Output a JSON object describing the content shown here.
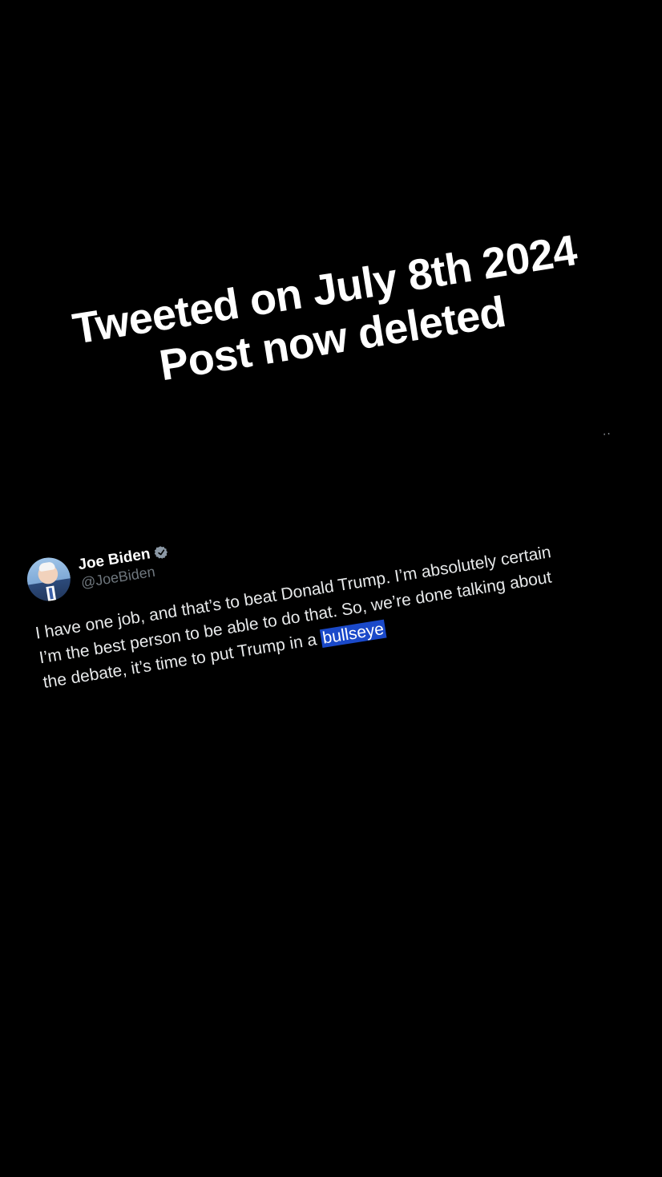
{
  "caption": {
    "line1": "Tweeted on July 8th 2024",
    "line2": "Post now deleted"
  },
  "more_menu": {
    "label": "··"
  },
  "tweet": {
    "display_name": "Joe Biden",
    "handle": "@JoeBiden",
    "verified_icon": "verified-badge",
    "body_line1": "I have one job, and that’s to beat Donald Trump. I’m absolutely certain",
    "body_line2": "I’m the best person to be able to do that. So, we’re done talking about",
    "body_line3_prefix": "the debate, it’s time to put Trump in a ",
    "body_highlight": "bullseye",
    "highlight_color": "#1a49c9"
  }
}
